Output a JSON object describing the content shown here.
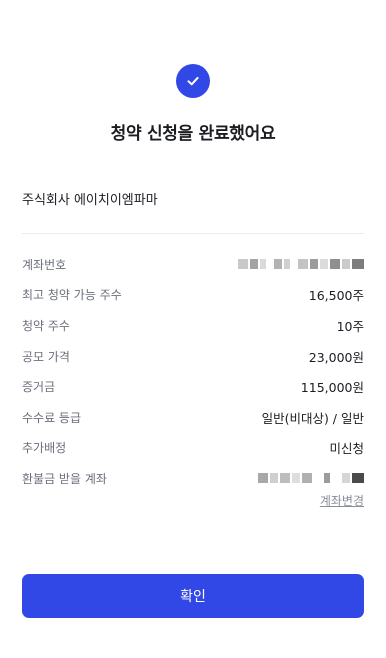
{
  "header": {
    "title": "청약 신청을 완료했어요"
  },
  "company": {
    "name": "주식회사 에이치이엠파마"
  },
  "details": [
    {
      "label": "계좌번호",
      "value": "",
      "masked": true
    },
    {
      "label": "최고 청약 가능 주수",
      "value": "16,500주"
    },
    {
      "label": "청약 주수",
      "value": "10주"
    },
    {
      "label": "공모 가격",
      "value": "23,000원"
    },
    {
      "label": "증거금",
      "value": "115,000원"
    },
    {
      "label": "수수료 등급",
      "value": "일반(비대상) / 일반"
    },
    {
      "label": "추가배정",
      "value": "미신청"
    },
    {
      "label": "환불금 받을 계좌",
      "value": "",
      "masked": true
    }
  ],
  "links": {
    "change_account": "계좌변경"
  },
  "actions": {
    "confirm": "확인"
  },
  "colors": {
    "accent": "#3248e6",
    "label": "#6b6f7b",
    "text": "#1b1d23"
  },
  "icons": {
    "status": "check-circle-icon"
  }
}
